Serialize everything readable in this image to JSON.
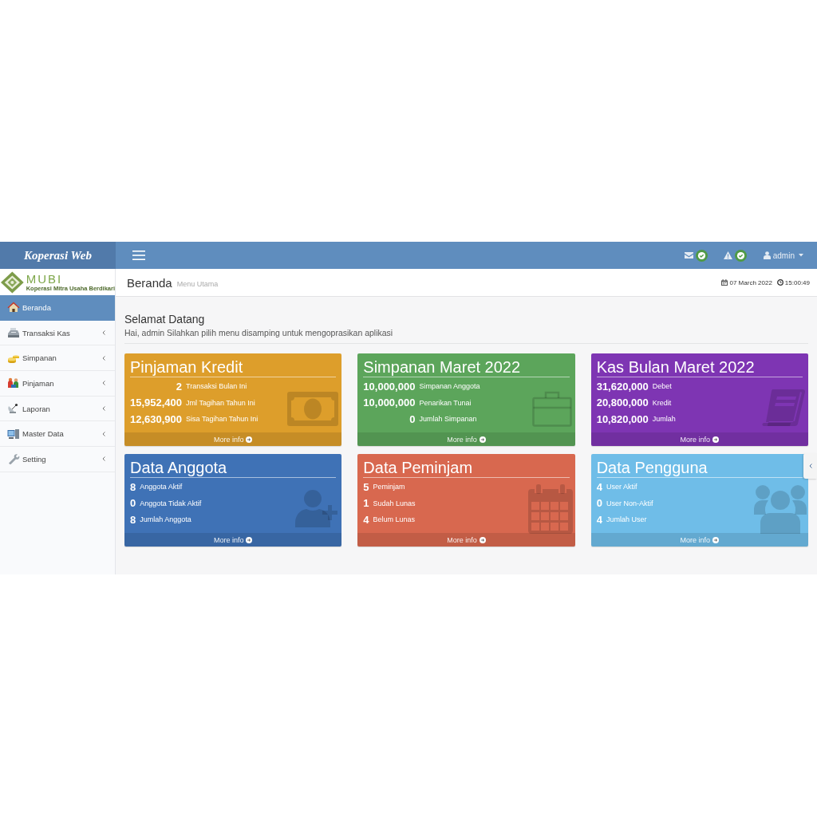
{
  "navbar": {
    "brand": "Koperasi Web",
    "user": "admin"
  },
  "sidebar": {
    "logo": {
      "title": "MUBI",
      "subtitle": "Koperasi Mitra Usaha Berdikari"
    },
    "items": [
      {
        "label": "Beranda",
        "selected": true,
        "has_submenu": false
      },
      {
        "label": "Transaksi Kas",
        "selected": false,
        "has_submenu": true
      },
      {
        "label": "Simpanan",
        "selected": false,
        "has_submenu": true
      },
      {
        "label": "Pinjaman",
        "selected": false,
        "has_submenu": true
      },
      {
        "label": "Laporan",
        "selected": false,
        "has_submenu": true
      },
      {
        "label": "Master Data",
        "selected": false,
        "has_submenu": true
      },
      {
        "label": "Setting",
        "selected": false,
        "has_submenu": true
      }
    ]
  },
  "page_header": {
    "title": "Beranda",
    "subtitle": "Menu Utama",
    "date": "07 March 2022",
    "time": "15:00:49"
  },
  "welcome": {
    "title": "Selamat Datang",
    "text": "Hai, admin Silahkan pilih menu disamping untuk mengoprasikan aplikasi"
  },
  "cards": [
    {
      "title": "Pinjaman Kredit",
      "color": "#dd9e2b",
      "rows": [
        {
          "value": "2",
          "label": "Transaksi Bulan Ini"
        },
        {
          "value": "15,952,400",
          "label": "Jml Tagihan Tahun Ini"
        },
        {
          "value": "12,630,900",
          "label": "Sisa Tagihan Tahun Ini"
        }
      ],
      "link": "More info"
    },
    {
      "title": "Simpanan Maret 2022",
      "color": "#5ca55b",
      "rows": [
        {
          "value": "10,000,000",
          "label": "Simpanan Anggota"
        },
        {
          "value": "10,000,000",
          "label": "Penarikan Tunai"
        },
        {
          "value": "0",
          "label": "Jumlah Simpanan"
        }
      ],
      "link": "More info"
    },
    {
      "title": "Kas Bulan Maret 2022",
      "color": "#7e35b3",
      "rows": [
        {
          "value": "31,620,000",
          "label": "Debet"
        },
        {
          "value": "20,800,000",
          "label": "Kredit"
        },
        {
          "value": "10,820,000",
          "label": "Jumlah"
        }
      ],
      "link": "More info"
    },
    {
      "title": "Data Anggota",
      "color": "#3f72b6",
      "rows": [
        {
          "value": "8",
          "label": "Anggota Aktif"
        },
        {
          "value": "0",
          "label": "Anggota Tidak Aktif"
        },
        {
          "value": "8",
          "label": "Jumlah Anggota"
        }
      ],
      "link": "More info"
    },
    {
      "title": "Data Peminjam",
      "color": "#d8684f",
      "rows": [
        {
          "value": "5",
          "label": "Peminjam"
        },
        {
          "value": "1",
          "label": "Sudah Lunas"
        },
        {
          "value": "4",
          "label": "Belum Lunas"
        }
      ],
      "link": "More info"
    },
    {
      "title": "Data Pengguna",
      "color": "#6fbde8",
      "rows": [
        {
          "value": "4",
          "label": "User Aktif"
        },
        {
          "value": "0",
          "label": "User Non-Aktif"
        },
        {
          "value": "4",
          "label": "Jumlah User"
        }
      ],
      "link": "More info"
    }
  ]
}
